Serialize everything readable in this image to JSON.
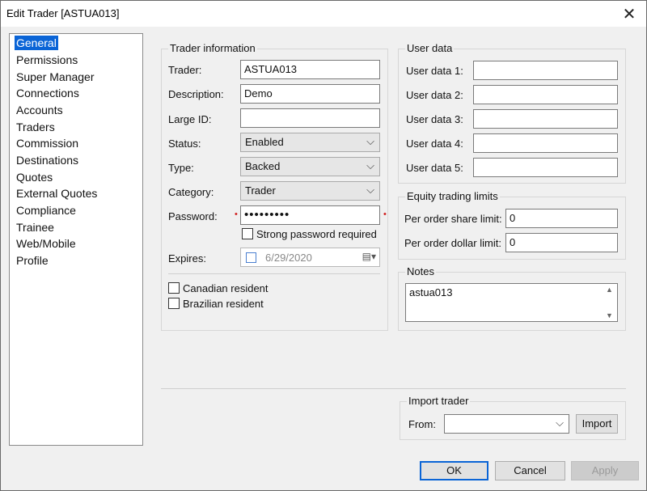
{
  "window": {
    "title": "Edit Trader [ASTUA013]",
    "close_glyph": "✕"
  },
  "nav": {
    "items": [
      "General",
      "Permissions",
      "Super Manager",
      "Connections",
      "Accounts",
      "Traders",
      "Commission",
      "Destinations",
      "Quotes",
      "External Quotes",
      "Compliance",
      "Trainee",
      "Web/Mobile",
      "Profile"
    ],
    "selected": "General"
  },
  "trader_info": {
    "legend": "Trader information",
    "trader_label": "Trader:",
    "trader_value": "ASTUA013",
    "description_label": "Description:",
    "description_value": "Demo",
    "large_id_label": "Large ID:",
    "large_id_value": "",
    "status_label": "Status:",
    "status_value": "Enabled",
    "type_label": "Type:",
    "type_value": "Backed",
    "category_label": "Category:",
    "category_value": "Trader",
    "password_label": "Password:",
    "password_value": "•••••••••",
    "strong_password_label": "Strong password required",
    "expires_label": "Expires:",
    "expires_value": "6/29/2020",
    "canadian_label": "Canadian resident",
    "brazilian_label": "Brazilian resident"
  },
  "user_data": {
    "legend": "User data",
    "fields": [
      {
        "label": "User data 1:",
        "value": ""
      },
      {
        "label": "User data 2:",
        "value": ""
      },
      {
        "label": "User data 3:",
        "value": ""
      },
      {
        "label": "User data 4:",
        "value": ""
      },
      {
        "label": "User data 5:",
        "value": ""
      }
    ]
  },
  "equity_limits": {
    "legend": "Equity trading limits",
    "share_label": "Per order share limit:",
    "share_value": "0",
    "dollar_label": "Per order dollar limit:",
    "dollar_value": "0"
  },
  "notes": {
    "legend": "Notes",
    "value": "astua013"
  },
  "import": {
    "legend": "Import trader",
    "from_label": "From:",
    "from_value": "",
    "import_button": "Import"
  },
  "footer": {
    "ok": "OK",
    "cancel": "Cancel",
    "apply": "Apply"
  },
  "icons": {
    "chevron": "chevron-down-icon",
    "close": "close-icon",
    "calendar": "calendar-icon"
  }
}
